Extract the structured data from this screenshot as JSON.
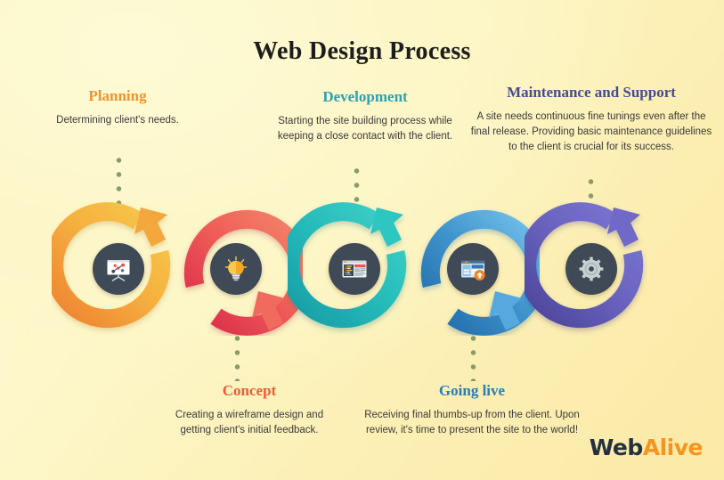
{
  "title": "Web Design Process",
  "background": {
    "color_top_left": "#fdfbd8",
    "color_bottom_right": "#fbe9a6",
    "dot_color": "#8a9a6b"
  },
  "steps": [
    {
      "id": "planning",
      "heading": "Planning",
      "body": "Determining client's needs.",
      "heading_color": "#f0932b",
      "arc_color_light": "#f7c94b",
      "arc_color_dark": "#ee8131",
      "icon_name": "presentation-board-icon",
      "position": "above"
    },
    {
      "id": "concept",
      "heading": "Concept",
      "body": "Creating a wireframe design and getting client's initial feedback.",
      "heading_color": "#ef5b37",
      "arc_color_light": "#f4735e",
      "arc_color_dark": "#d9294b",
      "icon_name": "lightbulb-icon",
      "position": "below"
    },
    {
      "id": "development",
      "heading": "Development",
      "body": "Starting the site building process while keeping a close contact with the client.",
      "heading_color": "#28a3b0",
      "arc_color_light": "#3fd1c7",
      "arc_color_dark": "#169ca6",
      "icon_name": "code-window-icon",
      "position": "above"
    },
    {
      "id": "going-live",
      "heading": "Going live",
      "body": "Receiving final thumbs-up from the client. Upon review, it's time to present the site to the world!",
      "heading_color": "#2b7bb9",
      "arc_color_light": "#63b8e8",
      "arc_color_dark": "#1f6aa8",
      "icon_name": "site-launch-icon",
      "position": "below"
    },
    {
      "id": "maintenance",
      "heading": "Maintenance and Support",
      "body": "A site needs continuous fine tunings even after the final release. Providing basic maintenance guidelines to the client is crucial for its success.",
      "heading_color": "#464c8f",
      "arc_color_light": "#7b76d4",
      "arc_color_dark": "#4a4498",
      "icon_name": "gear-icon",
      "position": "above"
    }
  ],
  "logo": {
    "part_one": "Web",
    "part_two": "Alive",
    "part_one_color": "#26303f",
    "part_two_color": "#f7941e"
  }
}
